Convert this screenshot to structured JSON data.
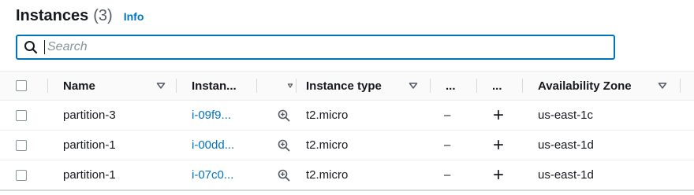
{
  "header": {
    "title": "Instances",
    "count": "(3)",
    "info": "Info"
  },
  "search": {
    "placeholder": "Search",
    "value": ""
  },
  "columns": {
    "name": "Name",
    "instance_id": "Instan...",
    "instance_type": "Instance type",
    "col4": "...",
    "col5": "...",
    "az": "Availability Zone"
  },
  "rows": [
    {
      "name": "partition-3",
      "instance_id": "i-09f9...",
      "instance_type": "t2.micro",
      "col4": "–",
      "col5": "+",
      "az": "us-east-1c"
    },
    {
      "name": "partition-1",
      "instance_id": "i-00dd...",
      "instance_type": "t2.micro",
      "col4": "–",
      "col5": "+",
      "az": "us-east-1d"
    },
    {
      "name": "partition-1",
      "instance_id": "i-07c0...",
      "instance_type": "t2.micro",
      "col4": "–",
      "col5": "+",
      "az": "us-east-1d"
    }
  ],
  "colors": {
    "accent": "#0073bb",
    "text": "#16191f",
    "border": "#eaeded"
  },
  "icons": {
    "search": "search-icon",
    "sort": "sort-caret-icon",
    "zoom": "zoom-in-icon"
  }
}
